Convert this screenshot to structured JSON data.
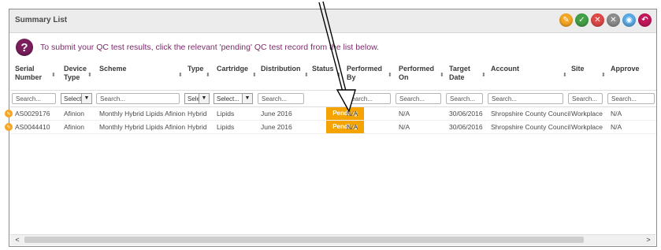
{
  "panel": {
    "title": "Summary List",
    "header_icons": [
      {
        "name": "edit-icon",
        "glyph": "✎",
        "color": "#f5a623"
      },
      {
        "name": "approve-icon",
        "glyph": "✓",
        "color": "#43a047"
      },
      {
        "name": "reject-icon",
        "glyph": "✕",
        "color": "#e04848"
      },
      {
        "name": "clear-icon",
        "glyph": "✕",
        "color": "#8c8c8c"
      },
      {
        "name": "view-icon",
        "glyph": "◉",
        "color": "#5aa9e6"
      },
      {
        "name": "back-icon",
        "glyph": "↶",
        "color": "#c2185b"
      }
    ]
  },
  "notice": {
    "icon": "question-icon",
    "icon_glyph": "?",
    "text": "To submit your QC test results, click the relevant 'pending' QC test record from the list below."
  },
  "columns": [
    {
      "key": "serial",
      "label": "Serial Number",
      "filter": {
        "type": "search",
        "placeholder": "Search..."
      }
    },
    {
      "key": "device",
      "label": "Device Type",
      "filter": {
        "type": "select",
        "value": "Select"
      }
    },
    {
      "key": "scheme",
      "label": "Scheme",
      "filter": {
        "type": "search",
        "placeholder": "Search..."
      }
    },
    {
      "key": "type",
      "label": "Type",
      "filter": {
        "type": "select",
        "value": "Sele"
      }
    },
    {
      "key": "cartridge",
      "label": "Cartridge",
      "filter": {
        "type": "select",
        "value": "Select..."
      }
    },
    {
      "key": "distribution",
      "label": "Distribution",
      "filter": {
        "type": "search",
        "placeholder": "Search..."
      }
    },
    {
      "key": "status",
      "label": "Status",
      "filter": {
        "type": "none"
      }
    },
    {
      "key": "performed_by",
      "label": "Performed By",
      "filter": {
        "type": "search",
        "placeholder": "Search..."
      }
    },
    {
      "key": "performed_on",
      "label": "Performed On",
      "filter": {
        "type": "search",
        "placeholder": "Search..."
      }
    },
    {
      "key": "target_date",
      "label": "Target Date",
      "filter": {
        "type": "search",
        "placeholder": "Search..."
      }
    },
    {
      "key": "account",
      "label": "Account",
      "filter": {
        "type": "search",
        "placeholder": "Search..."
      }
    },
    {
      "key": "site",
      "label": "Site",
      "filter": {
        "type": "search",
        "placeholder": "Search..."
      }
    },
    {
      "key": "approve",
      "label": "Approve",
      "filter": {
        "type": "search",
        "placeholder": "Search..."
      }
    }
  ],
  "rows": [
    {
      "serial": "AS0029176",
      "device": "Afinion",
      "scheme": "Monthly Hybrid Lipids Afinion",
      "type": "Hybrid",
      "cartridge": "Lipids",
      "distribution": "June 2016",
      "status": "Pending",
      "performed_by": "N/A",
      "performed_on": "N/A",
      "target_date": "30/06/2016",
      "account": "Shropshire County Council",
      "site": "Workplace",
      "approve": "N/A"
    },
    {
      "serial": "AS0044410",
      "device": "Afinion",
      "scheme": "Monthly Hybrid Lipids Afinion",
      "type": "Hybrid",
      "cartridge": "Lipids",
      "distribution": "June 2016",
      "status": "Pending",
      "performed_by": "N/A",
      "performed_on": "N/A",
      "target_date": "30/06/2016",
      "account": "Shropshire County Council",
      "site": "Workplace",
      "approve": "N/A"
    }
  ],
  "row_icon": "edit-icon",
  "row_icon_glyph": "✎",
  "sort_icon_glyph": "⬍",
  "colors": {
    "pending": "#f4a300",
    "notice_text": "#7b2a6b",
    "question_icon": "#7a1f5c"
  },
  "scrollbar": {
    "left_arrow": "<",
    "right_arrow": ">"
  }
}
